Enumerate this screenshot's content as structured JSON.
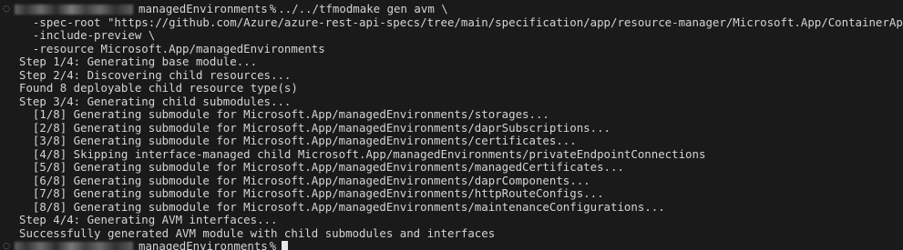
{
  "colors": {
    "background": "#1a1a1a",
    "text": "#d4d4d4",
    "marker": "#7f9bb5",
    "cursor": "#e8e8e8"
  },
  "prompt": {
    "marker_icon": "dotted-circle-icon",
    "directory": "managedEnvironments",
    "symbol": "%",
    "command": "../../tfmodmake gen avm \\"
  },
  "command_args": [
    "  -spec-root \"https://github.com/Azure/azure-rest-api-specs/tree/main/specification/app/resource-manager/Microsoft.App/ContainerApps\" \\",
    "  -include-preview \\",
    "  -resource Microsoft.App/managedEnvironments"
  ],
  "output_lines": [
    "Step 1/4: Generating base module...",
    "Step 2/4: Discovering child resources...",
    "Found 8 deployable child resource type(s)",
    "Step 3/4: Generating child submodules...",
    "  [1/8] Generating submodule for Microsoft.App/managedEnvironments/storages...",
    "  [2/8] Generating submodule for Microsoft.App/managedEnvironments/daprSubscriptions...",
    "  [3/8] Generating submodule for Microsoft.App/managedEnvironments/certificates...",
    "  [4/8] Skipping interface-managed child Microsoft.App/managedEnvironments/privateEndpointConnections",
    "  [5/8] Generating submodule for Microsoft.App/managedEnvironments/managedCertificates...",
    "  [6/8] Generating submodule for Microsoft.App/managedEnvironments/daprComponents...",
    "  [7/8] Generating submodule for Microsoft.App/managedEnvironments/httpRouteConfigs...",
    "  [8/8] Generating submodule for Microsoft.App/managedEnvironments/maintenanceConfigurations...",
    "Step 4/4: Generating AVM interfaces...",
    "Successfully generated AVM module with child submodules and interfaces"
  ],
  "final_prompt": {
    "marker_icon": "dotted-circle-icon",
    "directory": "managedEnvironments",
    "symbol": "%"
  }
}
